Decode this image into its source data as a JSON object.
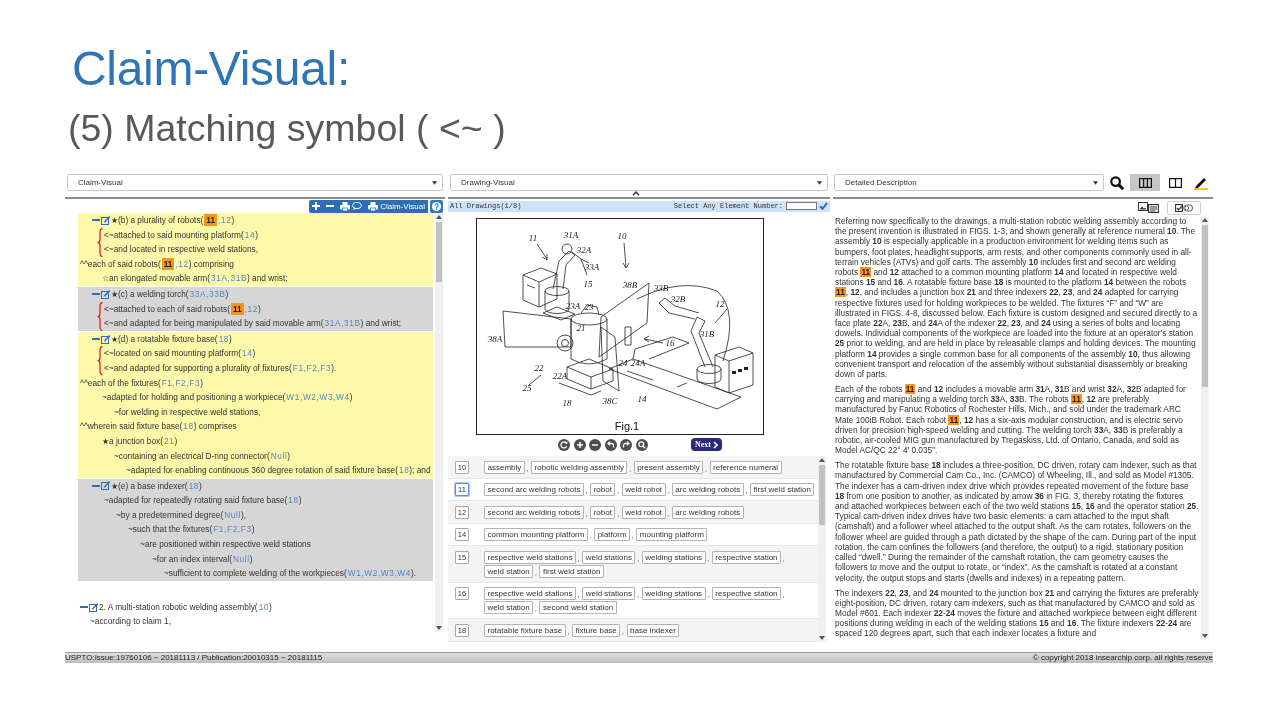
{
  "slide": {
    "title": "Claim-Visual:",
    "subtitle": "(5) Matching symbol ( <~ )"
  },
  "claim_panel": {
    "view": "Claim-Visual",
    "toolbar": [
      {
        "kind": "expand_all"
      },
      {
        "kind": "collapse_all"
      },
      {
        "kind": "print_comments"
      },
      {
        "kind": "print",
        "label": "Claim-Visual"
      },
      {
        "kind": "help"
      }
    ],
    "blocks": [
      {
        "color": "#fcf9ab",
        "items": [
          {
            "kind": "element",
            "expanded": true,
            "segments": [
              {
                "text": "★(b) a plurality of robots("
              },
              {
                "ref": "11",
                "highlighted": true
              },
              {
                "ref": ",12",
                "highlighted": false
              },
              {
                "text": ")"
              }
            ],
            "children": [
              {
                "kind": "brace",
                "children": [
                  {
                    "kind": "line",
                    "segments": [
                      {
                        "text": "<~attached to said mounting platform("
                      },
                      {
                        "ref": "14",
                        "highlighted": false
                      },
                      {
                        "text": ")"
                      }
                    ]
                  },
                  {
                    "kind": "line",
                    "segments": [
                      {
                        "text": "<~and located in respective weld stations,"
                      }
                    ]
                  }
                ]
              }
            ]
          },
          {
            "kind": "clause",
            "segments": [
              {
                "text": "^^each of said robots("
              },
              {
                "ref": "11",
                "highlighted": true
              },
              {
                "ref": ",12",
                "highlighted": false
              },
              {
                "text": ") comprising"
              }
            ],
            "children": [
              {
                "kind": "line",
                "segments": [
                  {
                    "text": "☆an elongated movable arm("
                  },
                  {
                    "ref": "31A,31B",
                    "highlighted": false
                  },
                  {
                    "text": ") and wrist;"
                  }
                ]
              }
            ]
          }
        ]
      },
      {
        "color": "#d6d6d6",
        "items": [
          {
            "kind": "element",
            "expanded": true,
            "segments": [
              {
                "text": "★(c) a welding torch("
              },
              {
                "ref": "33A,33B",
                "highlighted": false
              },
              {
                "text": ")"
              }
            ],
            "children": [
              {
                "kind": "brace",
                "children": [
                  {
                    "kind": "line",
                    "segments": [
                      {
                        "text": "<~attached to each of said robots("
                      },
                      {
                        "ref": "11",
                        "highlighted": true
                      },
                      {
                        "ref": ",12",
                        "highlighted": false
                      },
                      {
                        "text": ")"
                      }
                    ]
                  },
                  {
                    "kind": "line",
                    "segments": [
                      {
                        "text": "<~and adapted for being manipulated by said movable arm("
                      },
                      {
                        "ref": "31A,31B",
                        "highlighted": false
                      },
                      {
                        "text": ") and wrist;"
                      }
                    ]
                  }
                ]
              }
            ]
          }
        ]
      },
      {
        "color": "#fcf9ab",
        "items": [
          {
            "kind": "element",
            "expanded": true,
            "segments": [
              {
                "text": "★(d) a rotatable fixture base("
              },
              {
                "ref": "18",
                "highlighted": false
              },
              {
                "text": ")"
              }
            ],
            "children": [
              {
                "kind": "brace",
                "children": [
                  {
                    "kind": "line",
                    "segments": [
                      {
                        "text": "<~located on said mounting platform("
                      },
                      {
                        "ref": "14",
                        "highlighted": false
                      },
                      {
                        "text": ")"
                      }
                    ]
                  },
                  {
                    "kind": "line",
                    "segments": [
                      {
                        "text": "<~and adapted for supporting a plurality of fixtures("
                      },
                      {
                        "ref": "F1,F2,F3",
                        "highlighted": false
                      },
                      {
                        "text": ")."
                      }
                    ]
                  }
                ]
              }
            ]
          },
          {
            "kind": "clause",
            "segments": [
              {
                "text": "^^each of the fixtures("
              },
              {
                "ref": "F1,F2,F3",
                "highlighted": false
              },
              {
                "text": ")"
              }
            ],
            "children": [
              {
                "kind": "line",
                "segments": [
                  {
                    "text": "~adapted for holding and positioning a workpiece("
                  },
                  {
                    "ref": "W1,W2,W3,W4",
                    "highlighted": false
                  },
                  {
                    "text": ")"
                  }
                ],
                "children": [
                  {
                    "kind": "line",
                    "segments": [
                      {
                        "text": "~for welding in respective weld stations,"
                      }
                    ]
                  }
                ]
              }
            ]
          },
          {
            "kind": "clause",
            "segments": [
              {
                "text": "^^wherein said fixture base("
              },
              {
                "ref": "18",
                "highlighted": false
              },
              {
                "text": ") comprises"
              }
            ],
            "children": [
              {
                "kind": "line",
                "segments": [
                  {
                    "text": "★a junction box("
                  },
                  {
                    "ref": "21",
                    "highlighted": false
                  },
                  {
                    "text": ")"
                  }
                ],
                "children": [
                  {
                    "kind": "line",
                    "segments": [
                      {
                        "text": "~containing an electrical D-ring connector("
                      },
                      {
                        "ref": "Null",
                        "highlighted": false
                      },
                      {
                        "text": ")"
                      }
                    ],
                    "children": [
                      {
                        "kind": "line",
                        "segments": [
                          {
                            "text": "~adapted for enabling continuous 360 degree rotation of said fixture base("
                          },
                          {
                            "ref": "18",
                            "highlighted": false
                          },
                          {
                            "text": "); and"
                          }
                        ]
                      }
                    ]
                  }
                ]
              }
            ]
          }
        ]
      },
      {
        "color": "#d6d6d6",
        "items": [
          {
            "kind": "element",
            "expanded": true,
            "segments": [
              {
                "text": "★(e) a base indexer("
              },
              {
                "ref": "18",
                "highlighted": false
              },
              {
                "text": ")"
              }
            ],
            "children": [
              {
                "kind": "line",
                "segments": [
                  {
                    "text": "~adapted for repeatedly rotating said fixture base("
                  },
                  {
                    "ref": "18",
                    "highlighted": false
                  },
                  {
                    "text": ")"
                  }
                ],
                "children": [
                  {
                    "kind": "line",
                    "segments": [
                      {
                        "text": "~by a predetermined degree("
                      },
                      {
                        "ref": "Null",
                        "highlighted": false
                      },
                      {
                        "text": "),"
                      }
                    ],
                    "children": [
                      {
                        "kind": "line",
                        "segments": [
                          {
                            "text": "~such that the fixtures("
                          },
                          {
                            "ref": "F1,F2,F3",
                            "highlighted": false
                          },
                          {
                            "text": ")"
                          }
                        ],
                        "children": [
                          {
                            "kind": "line",
                            "segments": [
                              {
                                "text": "~are positioned within respective weld stations"
                              }
                            ],
                            "children": [
                              {
                                "kind": "line",
                                "segments": [
                                  {
                                    "text": "~for an index interval("
                                  },
                                  {
                                    "ref": "Null",
                                    "highlighted": false
                                  },
                                  {
                                    "text": ")"
                                  }
                                ],
                                "children": [
                                  {
                                    "kind": "line",
                                    "segments": [
                                      {
                                        "text": "~sufficient to complete welding of the workpieces("
                                      },
                                      {
                                        "ref": "W1,W2,W3,W4",
                                        "highlighted": false
                                      },
                                      {
                                        "text": ")."
                                      }
                                    ]
                                  }
                                ]
                              }
                            ]
                          }
                        ]
                      }
                    ]
                  }
                ]
              }
            ]
          }
        ]
      },
      {
        "items": [
          {
            "kind": "claim",
            "expanded": true,
            "segments": [
              {
                "text": "2. A multi-station robotic welding assembly("
              },
              {
                "ref": "10",
                "highlighted": false
              },
              {
                "text": ")"
              }
            ],
            "children": [
              {
                "kind": "line",
                "segments": [
                  {
                    "text": "~according to claim 1,"
                  }
                ]
              }
            ]
          }
        ]
      }
    ]
  },
  "drawing_panel": {
    "view": "Drawing-Visual",
    "heading": "All Drawings(1/8)",
    "element_prompt": "Select Any Element Number:",
    "figure": {
      "caption": "Fig.1",
      "labels": [
        "11",
        "31A",
        "32A",
        "33A",
        "10",
        "15",
        "23A",
        "23",
        "38B",
        "33B",
        "32B",
        "12",
        "38A",
        "21",
        "16",
        "31B",
        "22",
        "24",
        "24A",
        "22A",
        "25",
        "18",
        "38C",
        "14"
      ]
    },
    "viewer_tools": [
      {
        "kind": "rotate"
      },
      {
        "kind": "zoom_in"
      },
      {
        "kind": "zoom_out"
      },
      {
        "kind": "undo"
      },
      {
        "kind": "redo"
      },
      {
        "kind": "magnify"
      }
    ],
    "next_button": "Next",
    "elements": [
      {
        "number": "10",
        "selected": false,
        "terms": [
          {
            "text": "assembly",
            "after": ","
          },
          {
            "text": "robotic welding assembly",
            "after": ","
          },
          {
            "text": "present assembly",
            "after": ","
          },
          {
            "text": "reference numeral"
          }
        ]
      },
      {
        "number": "11",
        "selected": true,
        "terms": [
          {
            "text": "second arc welding robots",
            "after": ","
          },
          {
            "text": "robot",
            "after": ","
          },
          {
            "text": "weld robot",
            "after": ","
          },
          {
            "text": "arc welding robots",
            "after": ","
          },
          {
            "text": "first weld station"
          }
        ]
      },
      {
        "number": "12",
        "selected": false,
        "terms": [
          {
            "text": "second arc welding robots",
            "after": ","
          },
          {
            "text": "robot",
            "after": ","
          },
          {
            "text": "weld robot",
            "after": ","
          },
          {
            "text": "arc welding robots"
          }
        ]
      },
      {
        "number": "14",
        "selected": false,
        "terms": [
          {
            "text": "common mounting platform",
            "after": ","
          },
          {
            "text": "platform",
            "after": ","
          },
          {
            "text": "mounting platform"
          }
        ]
      },
      {
        "number": "15",
        "selected": false,
        "terms": [
          {
            "text": "respective weld stations",
            "after": ","
          },
          {
            "text": "weld stations",
            "after": ","
          },
          {
            "text": "welding stations",
            "after": ","
          },
          {
            "text": "respective station",
            "after": ","
          },
          {
            "text": "weld station",
            "after": ","
          },
          {
            "text": "first weld station"
          }
        ]
      },
      {
        "number": "16",
        "selected": false,
        "terms": [
          {
            "text": "respective weld stations",
            "after": ","
          },
          {
            "text": "weld stations",
            "after": ","
          },
          {
            "text": "welding stations",
            "after": ","
          },
          {
            "text": "respective station",
            "after": ","
          },
          {
            "text": "weld station",
            "after": ","
          },
          {
            "text": "second weld station"
          }
        ]
      },
      {
        "number": "18",
        "selected": false,
        "terms": [
          {
            "text": "rotatable fixture base",
            "after": ","
          },
          {
            "text": "fixture base",
            "after": ","
          },
          {
            "text": "base indexer"
          }
        ]
      }
    ]
  },
  "description_panel": {
    "section": "Detailed Description",
    "tools": [
      {
        "kind": "search",
        "selected": false
      },
      {
        "kind": "three_column",
        "selected": true
      },
      {
        "kind": "two_column",
        "selected": false
      },
      {
        "kind": "highlighter",
        "selected": false
      }
    ],
    "view_toggles": [
      {
        "kind": "image_text"
      },
      {
        "kind": "check_toggle"
      }
    ],
    "paragraphs": [
      {
        "segments": [
          {
            "text": "Referring now specifically to the drawings, a multi-station robotic welding assembly according to the present invention is illustrated in FIGS. 1-3, and shown generally at reference numeral **10**. The assembly **10** is especially applicable in a production environment for welding items such as bumpers, foot plates, headlight supports, arm rests, and other components commonly used in all-terrain vehicles (ATVs) and golf carts. The assembly **10** includes first and second arc welding robots "
          },
          {
            "ref": "11",
            "highlighted": true
          },
          {
            "text": " and **12** attached to a common mounting platform **14** and located in respective weld stations **15** and **16**. A rotatable fixture base **18** is mounted to the platform **14** between the robots "
          },
          {
            "ref": "11",
            "highlighted": true
          },
          {
            "text": ", **12**, and includes a junction box **21** and three indexers **22**, **23**, and **24** adapted for carrying respective fixtures used for holding workpieces to be welded. The fixtures “F” and “W” are illustrated in FIGS. 4-8, discussed below. Each fixture is custom designed and secured directly to a face plate **22**A, **23**B, and **24**A of the indexer **22**, **23**, and **24** using a series of bolts and locating dowels. Individual components of the workpiece are loaded into the fixture at an operator's station **25** prior to welding, and are held in place by releasable clamps and holding devices. The mounting platform **14** provides a single common base for all components of the assembly **10**, thus allowing convenient transport and relocation of the assembly without substantial disassembly or breaking down of parts."
          }
        ]
      },
      {
        "segments": [
          {
            "text": "Each of the robots "
          },
          {
            "ref": "11",
            "highlighted": true
          },
          {
            "text": " and **12** includes a movable arm **31**A, **31**B and wrist **32**A, **32**B adapted for carrying and manipulating a welding torch **33**A, **33**B. The robots "
          },
          {
            "ref": "11",
            "highlighted": true
          },
          {
            "text": ", **12** are preferably manufactured by Fanuc Robotics of Rochester Hills, Mich., and sold under the trademark ARC Mate 100iB Robot. Each robot "
          },
          {
            "ref": "11",
            "highlighted": true
          },
          {
            "text": ", **12** has a six-axis modular construction, and is electric servo driven for precision high-speed welding and cutting. The welding torch **33**A, **33**B is preferably a robotic, air-cooled MIG gun manufactured by Tregaskiss, Ltd. of Ontario, Canada, and sold as Model AC/QC 22° 4' 0.035”."
          }
        ]
      },
      {
        "segments": [
          {
            "text": "The rotatable fixture base **18** includes a three-position, DC driven, rotary cam indexer, such as that manufactured by Commercial Cam Co., Inc. (CAMCO) of Wheeling, Ill., and sold as Model #1305. The indexer has a cam-driven index drive which provides repeated movement of the fixture base **18** from one position to another, as indicated by arrow **36** in FIG. 3, thereby rotating the fixtures and attached workpieces between each of the two weld stations **15**, **16** and the operator station **25**. Typical cam-driven index drives have two basic elements: a cam attached to the input shaft (camshaft) and a follower wheel attached to the output shaft. As the cam rotates, followers on the follower wheel are guided through a path dictated by the shape of the cam. During part of the input rotation, the cam confines the followers (and therefore, the output) to a rigid, stationary position called “dwell.” During the remainder of the camshaft rotation, the cam geometry causes the followers to move and the output to rotate, or “index”. As the camshaft is rotated at a constant velocity, the output stops and starts (dwells and indexes) in a repeating pattern."
          }
        ]
      },
      {
        "segments": [
          {
            "text": "The indexers **22**, **23**, and **24** mounted to the junction box **21** and carrying the fixtures are preferably eight-position, DC driven, rotary cam indexers, such as that manufactured by CAMCO and sold as Model #601. Each indexer **22**-**24** moves the fixture and attached workpiece between eight different positions during welding in each of the welding stations **15** and **16**. The fixture indexers **22**-**24** are spaced 120 degrees apart, such that each indexer locates a fixture and"
          }
        ]
      }
    ]
  },
  "status_bar": {
    "source": "USPTO:Issue:19760106 ~ 20181113 / Publication:20010315 ~ 20181115",
    "copyright": "© copyright 2018 insearchip corp. all rights reserve"
  }
}
